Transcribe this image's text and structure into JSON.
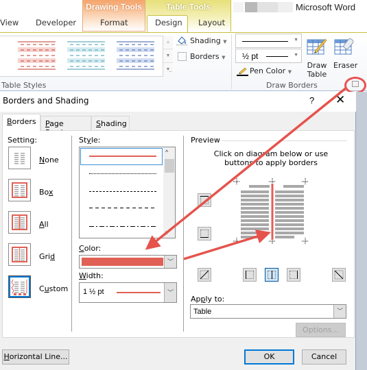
{
  "ribbon": {
    "app_title": "Microsoft Word",
    "context_tabs": {
      "drawing_tools": "Drawing Tools",
      "table_tools": "Table Tools"
    },
    "tabs": [
      {
        "label": "View"
      },
      {
        "label": "Developer"
      },
      {
        "label": "Format"
      },
      {
        "label": "Design",
        "active": true
      },
      {
        "label": "Layout"
      }
    ],
    "table_styles": {
      "group_label": "Table Styles",
      "styles": [
        {
          "name": "blue-partial",
          "color": "#2f64c4",
          "band": "#cdd9f2"
        },
        {
          "name": "red",
          "color": "#c0392b",
          "band": "#f6d3d0"
        },
        {
          "name": "teal",
          "color": "#3f9aad",
          "band": "#d4ebf0"
        },
        {
          "name": "blue",
          "color": "#3a5ea8",
          "band": "#d3ddf1"
        }
      ],
      "shading_label": "Shading",
      "borders_label": "Borders"
    },
    "draw_borders": {
      "group_label": "Draw Borders",
      "line_style": "solid",
      "line_weight": "½ pt",
      "pen_color_label": "Pen Color",
      "draw_table_label_1": "Draw",
      "draw_table_label_2": "Table",
      "eraser_label": "Eraser"
    }
  },
  "dialog": {
    "title": "Borders and Shading",
    "help": "?",
    "close": "✕",
    "tabs": [
      {
        "label": "Borders",
        "mnemonic": "B",
        "rest": "orders",
        "active": true
      },
      {
        "label": "Page Border",
        "mnemonic": "P",
        "rest": "age Border"
      },
      {
        "label": "Shading",
        "mnemonic": "S",
        "rest": "hading"
      }
    ],
    "setting": {
      "label": "Setting:",
      "options": [
        {
          "label": "None",
          "pre": "",
          "mn": "N",
          "post": "one"
        },
        {
          "label": "Box",
          "pre": "Bo",
          "mn": "x",
          "post": ""
        },
        {
          "label": "All",
          "pre": "",
          "mn": "A",
          "post": "ll"
        },
        {
          "label": "Grid",
          "pre": "Gri",
          "mn": "d",
          "post": ""
        },
        {
          "label": "Custom",
          "pre": "C",
          "mn": "u",
          "post": "stom",
          "selected": true
        }
      ]
    },
    "style": {
      "label_pre": "St",
      "label_mn": "y",
      "label_post": "le:",
      "items": [
        "solid",
        "dotted",
        "dashed-small",
        "dashed-large",
        "dash-dot"
      ],
      "selected": "solid"
    },
    "color": {
      "label_mn": "C",
      "label_post": "olor:",
      "value": "#e06055"
    },
    "width": {
      "label_mn": "W",
      "label_post": "idth:",
      "value": "1 ½ pt"
    },
    "preview": {
      "label": "Preview",
      "instruction_1": "Click on diagram below or use",
      "instruction_2": "buttons to apply borders",
      "buttons": [
        "top-border",
        "inside-horizontal-border",
        "bottom-border",
        "diagonal-up-border",
        "left-border",
        "inside-vertical-border",
        "right-border",
        "diagonal-down-border"
      ],
      "active_button": "inside-vertical-border"
    },
    "apply_to": {
      "label_pre": "Ap",
      "label_mn": "p",
      "label_post": "ly to:",
      "value": "Table"
    },
    "options_button": "Options...",
    "horizontal_line_button": {
      "mn": "H",
      "rest": "orizontal Line..."
    },
    "ok_button": "OK",
    "cancel_button": "Cancel"
  },
  "annotation": {
    "arrow_color": "#e5534b"
  }
}
